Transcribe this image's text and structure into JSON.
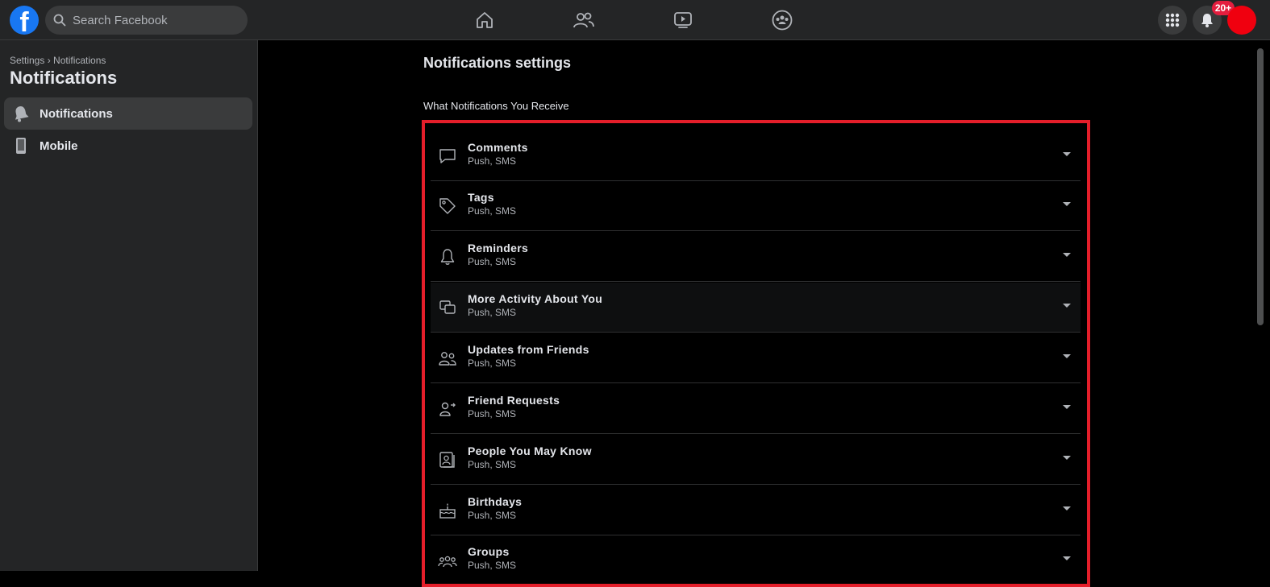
{
  "topbar": {
    "logo_letter": "f",
    "search_placeholder": "Search Facebook",
    "nav_icons": [
      "home-icon",
      "friends-icon",
      "watch-icon",
      "groups-icon"
    ],
    "menu_icon": "grid-menu-icon",
    "notifications_icon": "bell-icon",
    "notifications_badge": "20+"
  },
  "sidebar": {
    "breadcrumb_parent": "Settings",
    "breadcrumb_separator": "›",
    "breadcrumb_current": "Notifications",
    "title": "Notifications",
    "items": [
      {
        "label": "Notifications",
        "icon": "bell-icon",
        "active": true
      },
      {
        "label": "Mobile",
        "icon": "phone-icon",
        "active": false
      }
    ]
  },
  "main": {
    "title": "Notifications settings",
    "section_label": "What Notifications You Receive",
    "rows": [
      {
        "name": "Comments",
        "sub": "Push, SMS",
        "icon": "comment-icon"
      },
      {
        "name": "Tags",
        "sub": "Push, SMS",
        "icon": "tag-icon"
      },
      {
        "name": "Reminders",
        "sub": "Push, SMS",
        "icon": "bell-icon"
      },
      {
        "name": "More Activity About You",
        "sub": "Push, SMS",
        "icon": "activity-icon"
      },
      {
        "name": "Updates from Friends",
        "sub": "Push, SMS",
        "icon": "friends-icon"
      },
      {
        "name": "Friend Requests",
        "sub": "Push, SMS",
        "icon": "friend-request-icon"
      },
      {
        "name": "People You May Know",
        "sub": "Push, SMS",
        "icon": "contact-card-icon"
      },
      {
        "name": "Birthdays",
        "sub": "Push, SMS",
        "icon": "cake-icon"
      },
      {
        "name": "Groups",
        "sub": "Push, SMS",
        "icon": "groups-icon"
      }
    ]
  },
  "colors": {
    "accent": "#1877f2",
    "highlight_border": "#e41e2a",
    "badge": "#e41e3f",
    "avatar": "#f0000f"
  }
}
